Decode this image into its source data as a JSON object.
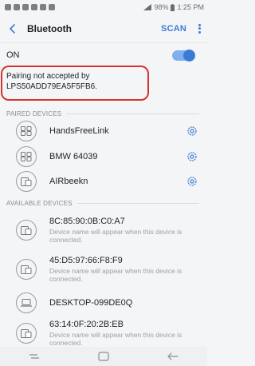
{
  "status_bar": {
    "battery": "98%",
    "time": "1:25 PM"
  },
  "header": {
    "title": "Bluetooth",
    "scan_label": "SCAN"
  },
  "toggle": {
    "label": "ON",
    "state": "on"
  },
  "alert": {
    "line1": "Pairing not accepted by",
    "line2": "LPS50ADD79EA5F5FB6."
  },
  "paired": {
    "header": "PAIRED DEVICES",
    "items": [
      {
        "name": "HandsFreeLink",
        "icon": "headset-icon"
      },
      {
        "name": "BMW 64039",
        "icon": "headset-icon"
      },
      {
        "name": "AIRbeekn",
        "icon": "tablet-icon"
      }
    ]
  },
  "available": {
    "header": "AVAILABLE DEVICES",
    "items": [
      {
        "name": "8C:85:90:0B:C0:A7",
        "sub": "Device name will appear when this device is connected.",
        "icon": "tablet-icon"
      },
      {
        "name": "45:D5:97:66:F8:F9",
        "sub": "Device name will appear when this device is connected.",
        "icon": "tablet-icon"
      },
      {
        "name": "DESKTOP-099DE0Q",
        "sub": "",
        "icon": "laptop-icon"
      },
      {
        "name": "63:14:0F:20:2B:EB",
        "sub": "Device name will appear when this device is connected.",
        "icon": "tablet-icon"
      }
    ]
  },
  "colors": {
    "accent": "#3b7bd8",
    "highlight": "#d63333"
  }
}
